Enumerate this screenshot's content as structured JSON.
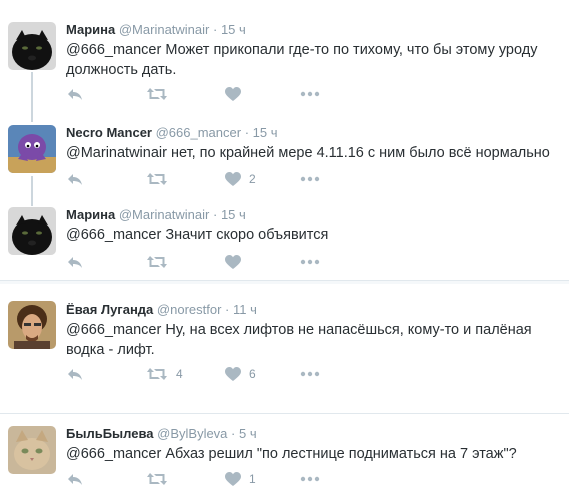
{
  "colors": {
    "text": "#292f33",
    "muted": "#8899a6",
    "icon": "#aab8c2",
    "thread_line": "#ccd6dd",
    "divider": "#e1e8ed"
  },
  "tweets": [
    {
      "name": "Марина",
      "handle": "@Marinatwinair",
      "time": "15 ч",
      "mention": "@666_mancer",
      "text": " Может прикопали где-то по тихому, что бы этому уроду должность дать.",
      "likes": "",
      "retweets": "",
      "avatar": "black-panther-avatar"
    },
    {
      "name": "Necro Mancer",
      "handle": "@666_mancer",
      "time": "15 ч",
      "mention": "@Marinatwinair",
      "text": " нет, по крайней мере 4.11.16 с ним было всё нормально",
      "likes": "2",
      "retweets": "",
      "avatar": "cartoon-creature-avatar"
    },
    {
      "name": "Марина",
      "handle": "@Marinatwinair",
      "time": "15 ч",
      "mention": "@666_mancer",
      "text": " Значит скоро объявится",
      "likes": "",
      "retweets": "",
      "avatar": "black-panther-avatar"
    },
    {
      "name": "Ёвая Луганда",
      "handle": "@norestfor",
      "time": "11 ч",
      "mention": "@666_mancer",
      "text": " Ну, на всех лифтов не напасёшься, кому-то и палёная водка - лифт.",
      "likes": "6",
      "retweets": "4",
      "avatar": "man-portrait-avatar"
    },
    {
      "name": "БыльБылева",
      "handle": "@BylByleva",
      "time": "5 ч",
      "mention": "@666_mancer",
      "text": " Абхаз решил \"по лестнице подниматься  на 7 этаж\"?",
      "likes": "1",
      "retweets": "",
      "avatar": "cat-avatar"
    }
  ]
}
